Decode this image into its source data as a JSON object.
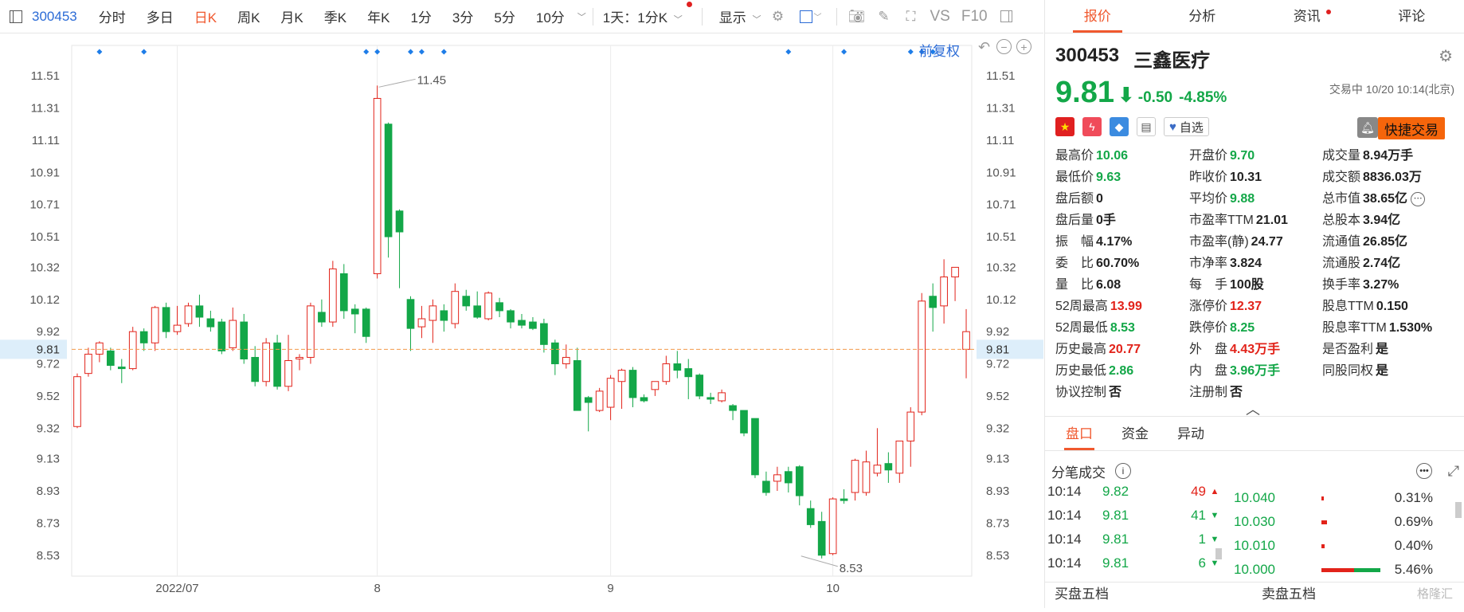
{
  "toolbar": {
    "code": "300453",
    "tabs": [
      "分时",
      "多日",
      "日K",
      "周K",
      "月K",
      "季K",
      "年K",
      "1分",
      "3分",
      "5分",
      "10分"
    ],
    "active_tab": "日K",
    "period_select": "1天：1分K",
    "display_label": "显示",
    "vs_label": "VS",
    "f10_label": "F10"
  },
  "chart_controls": {
    "fuquan_label": "前复权"
  },
  "chart_data": {
    "type": "candlestick",
    "y_ticks": [
      "11.51",
      "11.31",
      "11.11",
      "10.91",
      "10.71",
      "10.51",
      "10.32",
      "10.12",
      "9.92",
      "9.72",
      "9.52",
      "9.32",
      "9.13",
      "8.93",
      "8.73",
      "8.53"
    ],
    "y_range": [
      8.4,
      11.62
    ],
    "x_labels": [
      "2022/07",
      "8",
      "9",
      "10"
    ],
    "x_label_index": [
      9,
      27,
      48,
      68
    ],
    "current_price": 9.81,
    "current_price_label": "9.81",
    "high_annotation": {
      "value": 11.45,
      "label": "11.45",
      "index": 27
    },
    "low_annotation": {
      "value": 8.53,
      "label": "8.53",
      "index": 65
    },
    "event_marker_index": [
      2,
      6,
      26,
      27,
      30,
      31,
      33,
      64,
      69,
      75,
      76,
      77
    ],
    "candles": [
      [
        9.33,
        9.64,
        9.66,
        9.32
      ],
      [
        9.66,
        9.78,
        9.82,
        9.64
      ],
      [
        9.78,
        9.85,
        9.86,
        9.73
      ],
      [
        9.8,
        9.71,
        9.82,
        9.68
      ],
      [
        9.7,
        9.69,
        9.75,
        9.6
      ],
      [
        9.69,
        9.92,
        9.95,
        9.68
      ],
      [
        9.92,
        9.85,
        9.94,
        9.8
      ],
      [
        9.85,
        10.07,
        10.08,
        9.8
      ],
      [
        10.07,
        9.92,
        10.1,
        9.88
      ],
      [
        9.92,
        9.96,
        10.08,
        9.9
      ],
      [
        9.97,
        10.08,
        10.1,
        9.95
      ],
      [
        10.08,
        10.01,
        10.15,
        9.95
      ],
      [
        10.0,
        9.95,
        10.05,
        9.92
      ],
      [
        9.98,
        9.8,
        10.0,
        9.78
      ],
      [
        9.82,
        9.99,
        10.07,
        9.8
      ],
      [
        9.98,
        9.75,
        10.03,
        9.72
      ],
      [
        9.76,
        9.61,
        9.83,
        9.58
      ],
      [
        9.61,
        9.85,
        9.88,
        9.58
      ],
      [
        9.85,
        9.58,
        9.9,
        9.56
      ],
      [
        9.58,
        9.74,
        9.9,
        9.55
      ],
      [
        9.75,
        9.76,
        9.78,
        9.68
      ],
      [
        9.76,
        10.08,
        10.1,
        9.72
      ],
      [
        10.04,
        9.98,
        10.12,
        9.95
      ],
      [
        9.98,
        10.31,
        10.36,
        9.95
      ],
      [
        10.28,
        10.05,
        10.34,
        10.0
      ],
      [
        10.06,
        10.03,
        10.09,
        9.91
      ],
      [
        10.06,
        9.89,
        10.07,
        9.85
      ],
      [
        10.28,
        11.37,
        11.45,
        10.25
      ],
      [
        11.21,
        10.51,
        11.22,
        10.38
      ],
      [
        10.67,
        10.54,
        10.68,
        10.19
      ],
      [
        10.12,
        9.94,
        10.14,
        9.8
      ],
      [
        9.95,
        10.0,
        10.08,
        9.88
      ],
      [
        9.99,
        10.08,
        10.12,
        9.85
      ],
      [
        10.05,
        9.99,
        10.09,
        9.92
      ],
      [
        9.97,
        10.17,
        10.22,
        9.94
      ],
      [
        10.14,
        10.08,
        10.18,
        10.05
      ],
      [
        10.08,
        10.01,
        10.17,
        10.0
      ],
      [
        10.0,
        10.16,
        10.17,
        9.99
      ],
      [
        10.1,
        10.05,
        10.13,
        10.01
      ],
      [
        10.05,
        9.98,
        10.06,
        9.94
      ],
      [
        9.99,
        9.96,
        10.03,
        9.94
      ],
      [
        9.98,
        9.94,
        10.01,
        9.93
      ],
      [
        9.97,
        9.84,
        10.0,
        9.79
      ],
      [
        9.85,
        9.72,
        9.87,
        9.65
      ],
      [
        9.72,
        9.76,
        9.84,
        9.69
      ],
      [
        9.74,
        9.43,
        9.82,
        9.43
      ],
      [
        9.51,
        9.48,
        9.52,
        9.3
      ],
      [
        9.43,
        9.55,
        9.57,
        9.42
      ],
      [
        9.45,
        9.63,
        9.65,
        9.37
      ],
      [
        9.61,
        9.68,
        9.69,
        9.44
      ],
      [
        9.68,
        9.51,
        9.7,
        9.45
      ],
      [
        9.51,
        9.49,
        9.53,
        9.48
      ],
      [
        9.56,
        9.61,
        9.61,
        9.52
      ],
      [
        9.61,
        9.72,
        9.77,
        9.59
      ],
      [
        9.72,
        9.68,
        9.8,
        9.63
      ],
      [
        9.69,
        9.64,
        9.75,
        9.5
      ],
      [
        9.65,
        9.52,
        9.66,
        9.5
      ],
      [
        9.51,
        9.5,
        9.54,
        9.47
      ],
      [
        9.49,
        9.54,
        9.56,
        9.48
      ],
      [
        9.46,
        9.43,
        9.47,
        9.37
      ],
      [
        9.43,
        9.29,
        9.43,
        9.27
      ],
      [
        9.38,
        9.03,
        9.38,
        9.01
      ],
      [
        8.99,
        8.92,
        9.05,
        8.9
      ],
      [
        8.99,
        9.03,
        9.08,
        8.93
      ],
      [
        9.05,
        8.98,
        9.08,
        8.92
      ],
      [
        9.08,
        8.9,
        9.09,
        8.84
      ],
      [
        8.82,
        8.72,
        8.87,
        8.7
      ],
      [
        8.74,
        8.53,
        8.8,
        8.51
      ],
      [
        8.54,
        8.88,
        8.89,
        8.53
      ],
      [
        8.88,
        8.87,
        8.94,
        8.85
      ],
      [
        8.92,
        9.12,
        9.13,
        8.87
      ],
      [
        8.92,
        9.11,
        9.18,
        8.9
      ],
      [
        9.04,
        9.09,
        9.32,
        9.02
      ],
      [
        9.1,
        9.06,
        9.17,
        8.98
      ],
      [
        9.04,
        9.24,
        9.24,
        8.98
      ],
      [
        9.24,
        9.42,
        9.45,
        9.08
      ],
      [
        9.42,
        10.11,
        10.16,
        9.4
      ],
      [
        10.14,
        10.07,
        10.22,
        9.92
      ],
      [
        10.08,
        10.26,
        10.37,
        9.97
      ],
      [
        10.26,
        10.32,
        10.3,
        10.11
      ],
      [
        9.81,
        9.92,
        10.06,
        9.63
      ]
    ]
  },
  "right_tabs": [
    "报价",
    "分析",
    "资讯",
    "评论"
  ],
  "stock": {
    "code": "300453",
    "name": "三鑫医疗",
    "price": "9.81",
    "change": "-0.50",
    "change_pct": "-4.85%",
    "status_time": "交易中 10/20 10:14(北京)",
    "watch_label": "自选",
    "quick_trade_label": "快捷交易"
  },
  "stats": [
    {
      "label": "最高价",
      "value": "10.06",
      "cls": "down"
    },
    {
      "label": "开盘价",
      "value": "9.70",
      "cls": "down"
    },
    {
      "label": "成交量",
      "value": "8.94万手",
      "cls": "neutral"
    },
    {
      "label": "最低价",
      "value": "9.63",
      "cls": "down"
    },
    {
      "label": "昨收价",
      "value": "10.31",
      "cls": "neutral"
    },
    {
      "label": "成交额",
      "value": "8836.03万",
      "cls": "neutral"
    },
    {
      "label": "盘后额",
      "value": "0",
      "cls": "neutral"
    },
    {
      "label": "平均价",
      "value": "9.88",
      "cls": "down"
    },
    {
      "label": "总市值",
      "value": "38.65亿",
      "cls": "neutral"
    },
    {
      "label": "盘后量",
      "value": "0手",
      "cls": "neutral"
    },
    {
      "label": "市盈率TTM",
      "value": "21.01",
      "cls": "neutral"
    },
    {
      "label": "总股本",
      "value": "3.94亿",
      "cls": "neutral"
    },
    {
      "label": "振　幅",
      "value": "4.17%",
      "cls": "neutral"
    },
    {
      "label": "市盈率(静)",
      "value": "24.77",
      "cls": "neutral"
    },
    {
      "label": "流通值",
      "value": "26.85亿",
      "cls": "neutral"
    },
    {
      "label": "委　比",
      "value": "60.70%",
      "cls": "neutral"
    },
    {
      "label": "市净率",
      "value": "3.824",
      "cls": "neutral"
    },
    {
      "label": "流通股",
      "value": "2.74亿",
      "cls": "neutral"
    },
    {
      "label": "量　比",
      "value": "6.08",
      "cls": "neutral"
    },
    {
      "label": "每　手",
      "value": "100股",
      "cls": "neutral"
    },
    {
      "label": "换手率",
      "value": "3.27%",
      "cls": "neutral"
    },
    {
      "label": "52周最高",
      "value": "13.99",
      "cls": "up"
    },
    {
      "label": "涨停价",
      "value": "12.37",
      "cls": "up"
    },
    {
      "label": "股息TTM",
      "value": "0.150",
      "cls": "neutral"
    },
    {
      "label": "52周最低",
      "value": "8.53",
      "cls": "down"
    },
    {
      "label": "跌停价",
      "value": "8.25",
      "cls": "down"
    },
    {
      "label": "股息率TTM",
      "value": "1.530%",
      "cls": "neutral"
    },
    {
      "label": "历史最高",
      "value": "20.77",
      "cls": "up"
    },
    {
      "label": "外　盘",
      "value": "4.43万手",
      "cls": "up"
    },
    {
      "label": "是否盈利",
      "value": "是",
      "cls": "neutral"
    },
    {
      "label": "历史最低",
      "value": "2.86",
      "cls": "down"
    },
    {
      "label": "内　盘",
      "value": "3.96万手",
      "cls": "down"
    },
    {
      "label": "同股同权",
      "value": "是",
      "cls": "neutral"
    },
    {
      "label": "协议控制",
      "value": "否",
      "cls": "neutral"
    },
    {
      "label": "注册制",
      "value": "否",
      "cls": "neutral"
    },
    {
      "label": "",
      "value": "",
      "cls": "neutral"
    }
  ],
  "sub_tabs": [
    "盘口",
    "资金",
    "异动"
  ],
  "trades_title": "分笔成交",
  "trades": [
    {
      "time": "10:14",
      "price": "9.82",
      "vol": "49",
      "dir": "up"
    },
    {
      "time": "10:14",
      "price": "9.81",
      "vol": "41",
      "dir": "down"
    },
    {
      "time": "10:14",
      "price": "9.81",
      "vol": "1",
      "dir": "down"
    },
    {
      "time": "10:14",
      "price": "9.81",
      "vol": "6",
      "dir": "down"
    }
  ],
  "depth": [
    {
      "price": "10.040",
      "pct": "0.31%",
      "red": 0.04,
      "green": 0
    },
    {
      "price": "10.030",
      "pct": "0.69%",
      "red": 0.09,
      "green": 0
    },
    {
      "price": "10.010",
      "pct": "0.40%",
      "red": 0.05,
      "green": 0
    },
    {
      "price": "10.000",
      "pct": "5.46%",
      "red": 0.55,
      "green": 0.45
    }
  ],
  "book_tabs": [
    "买盘五档",
    "卖盘五档"
  ],
  "watermark": "格隆汇",
  "colors": {
    "up": "#e2231a",
    "down": "#13a748",
    "accent": "#f0582e",
    "link": "#2b6bd6"
  }
}
